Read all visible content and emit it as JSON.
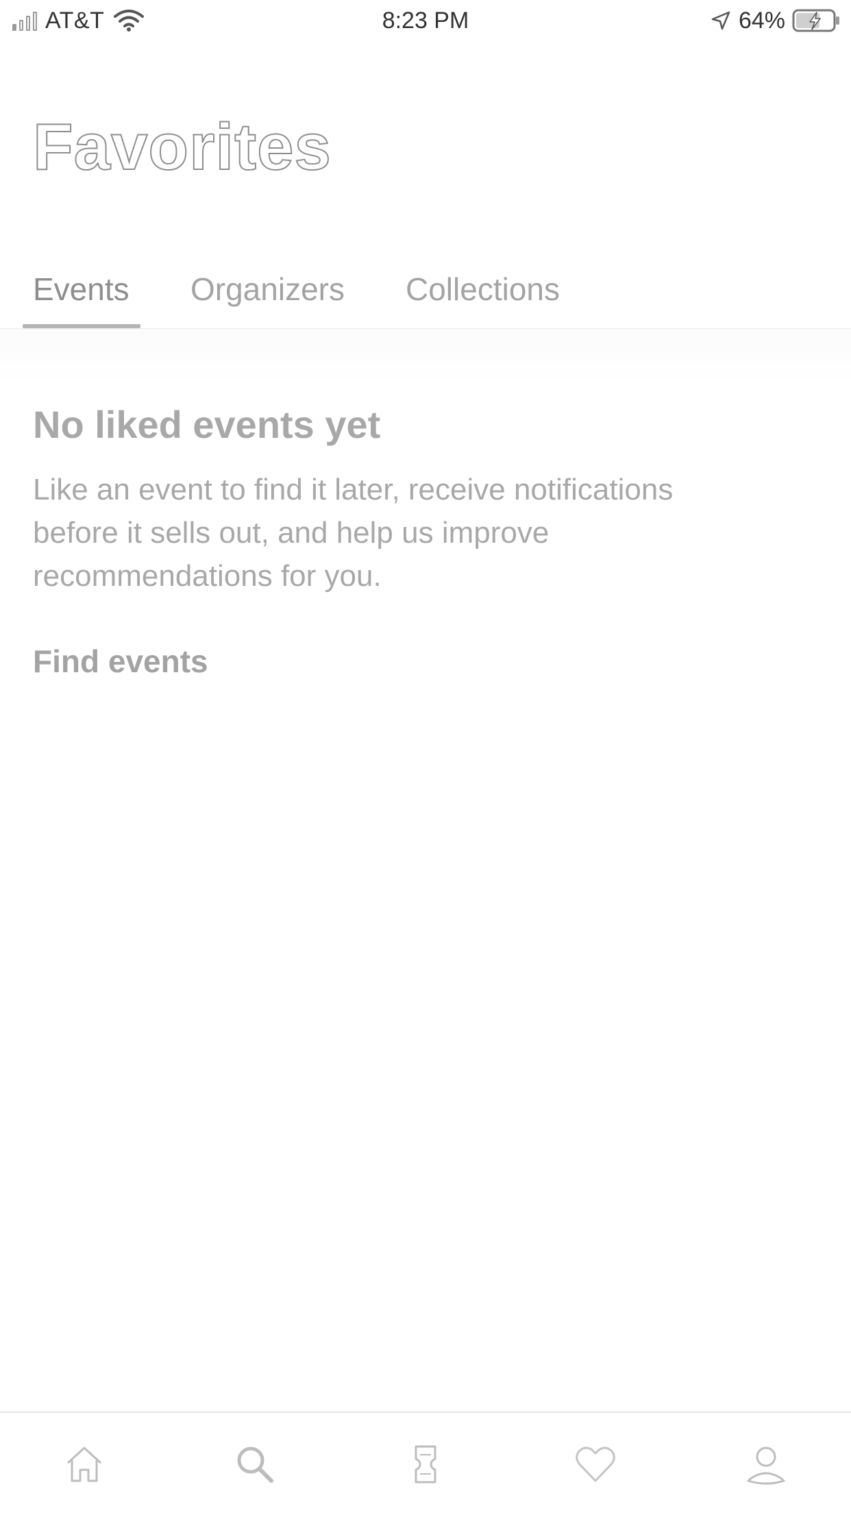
{
  "status_bar": {
    "carrier": "AT&T",
    "time": "8:23 PM",
    "battery_percent": "64%",
    "signal_bars_filled": 1,
    "signal_bars_total": 4,
    "icons": [
      "signal-icon",
      "wifi-icon",
      "location-arrow-icon",
      "battery-charging-icon"
    ]
  },
  "header": {
    "title": "Favorites"
  },
  "tabs": [
    {
      "label": "Events",
      "active": true
    },
    {
      "label": "Organizers",
      "active": false
    },
    {
      "label": "Collections",
      "active": false
    }
  ],
  "empty_state": {
    "heading": "No liked events yet",
    "body": "Like an event to find it later, receive notifications before it sells out, and help us improve recommendations for you.",
    "action_label": "Find events"
  },
  "bottom_nav": {
    "items": [
      {
        "icon": "home-icon",
        "active": false
      },
      {
        "icon": "search-icon",
        "active": false
      },
      {
        "icon": "ticket-icon",
        "active": false
      },
      {
        "icon": "heart-icon",
        "active": true
      },
      {
        "icon": "profile-icon",
        "active": false
      }
    ]
  },
  "colors": {
    "background": "#ffffff",
    "text_muted": "#a8a8a8",
    "icon": "#bdbdbd"
  }
}
